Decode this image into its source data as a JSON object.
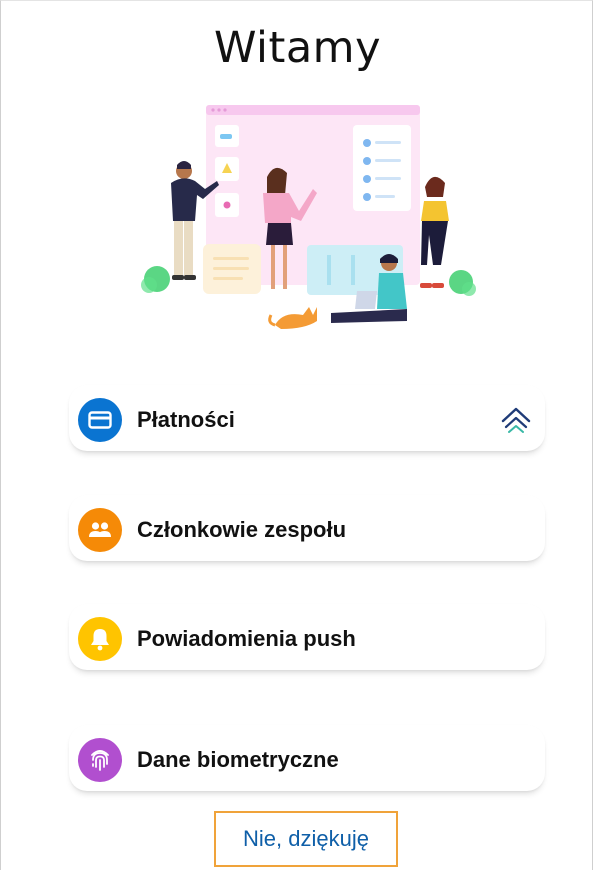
{
  "header": {
    "title": "Witamy"
  },
  "illustration": {
    "name": "team-collaboration-illustration"
  },
  "cards": [
    {
      "label": "Płatności",
      "icon": "credit-card-icon",
      "color": "#0a74d1",
      "has_expand": true
    },
    {
      "label": "Członkowie zespołu",
      "icon": "team-members-icon",
      "color": "#f58a07"
    },
    {
      "label": "Powiadomienia push",
      "icon": "bell-icon",
      "color": "#ffc400"
    },
    {
      "label": "Dane biometryczne",
      "icon": "fingerprint-icon",
      "color": "#b14fcf"
    }
  ],
  "footer": {
    "skip_label": "Nie, dziękuję",
    "skip_color": "#0f5fa8",
    "highlight_color": "#f0a33a"
  }
}
